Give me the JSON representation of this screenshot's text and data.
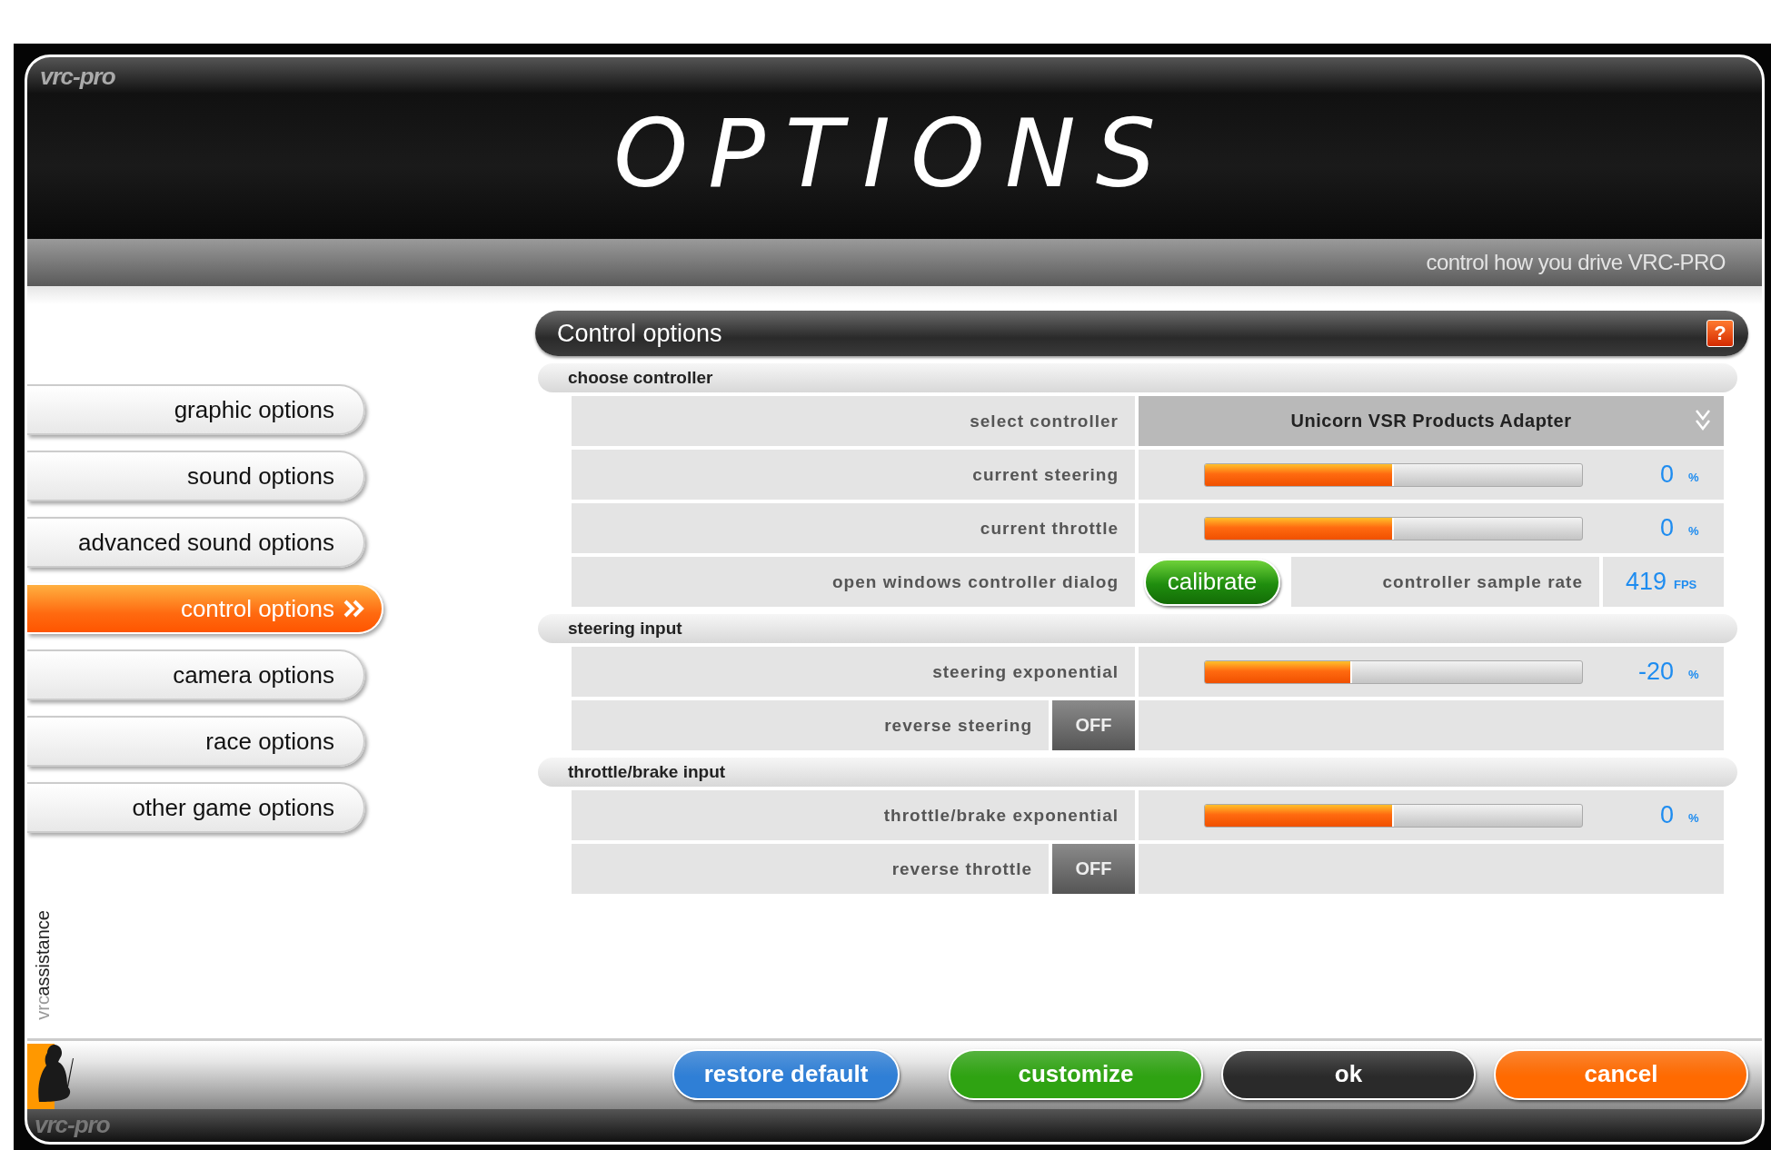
{
  "logo": "vrc-pro",
  "title": "OPTIONS",
  "subtitle": "control how you drive VRC-PRO",
  "sidebar": {
    "items": [
      {
        "label": "graphic options",
        "selected": false
      },
      {
        "label": "sound options",
        "selected": false
      },
      {
        "label": "advanced sound options",
        "selected": false
      },
      {
        "label": "control options",
        "selected": true
      },
      {
        "label": "camera options",
        "selected": false
      },
      {
        "label": "race options",
        "selected": false
      },
      {
        "label": "other game options",
        "selected": false
      }
    ],
    "assistance": {
      "prefix": "vrc",
      "label": "assistance"
    }
  },
  "panel": {
    "title": "Control options",
    "help": "?",
    "sections": [
      {
        "title": "choose controller",
        "rows": [
          {
            "kind": "select",
            "label": "select controller",
            "value": "Unicorn VSR Products Adapter"
          },
          {
            "kind": "meter",
            "label": "current steering",
            "level": 0.5,
            "reading": "0",
            "unit": "%"
          },
          {
            "kind": "meter",
            "label": "current throttle",
            "level": 0.5,
            "reading": "0",
            "unit": "%"
          },
          {
            "kind": "action",
            "label": "open windows controller dialog",
            "button": "calibrate",
            "extra_label": "controller sample rate",
            "reading": "419",
            "unit": "FPS"
          }
        ]
      },
      {
        "title": "steering input",
        "rows": [
          {
            "kind": "meter",
            "label": "steering exponential",
            "level": 0.39,
            "reading": "-20",
            "unit": "%"
          },
          {
            "kind": "toggle",
            "label": "reverse steering",
            "on": false,
            "state_text": "OFF"
          }
        ]
      },
      {
        "title": "throttle/brake input",
        "rows": [
          {
            "kind": "meter",
            "label": "throttle/brake exponential",
            "level": 0.5,
            "reading": "0",
            "unit": "%"
          },
          {
            "kind": "toggle",
            "label": "reverse throttle",
            "on": false,
            "state_text": "OFF"
          }
        ]
      }
    ]
  },
  "buttons": [
    {
      "label": "restore default",
      "color": "#2f7fd6"
    },
    {
      "label": "customize",
      "color": "#2fa312"
    },
    {
      "label": "ok",
      "color": "#2a2a2a"
    },
    {
      "label": "cancel",
      "color": "#ff6a00"
    }
  ],
  "footer_logo": "vrc-pro"
}
